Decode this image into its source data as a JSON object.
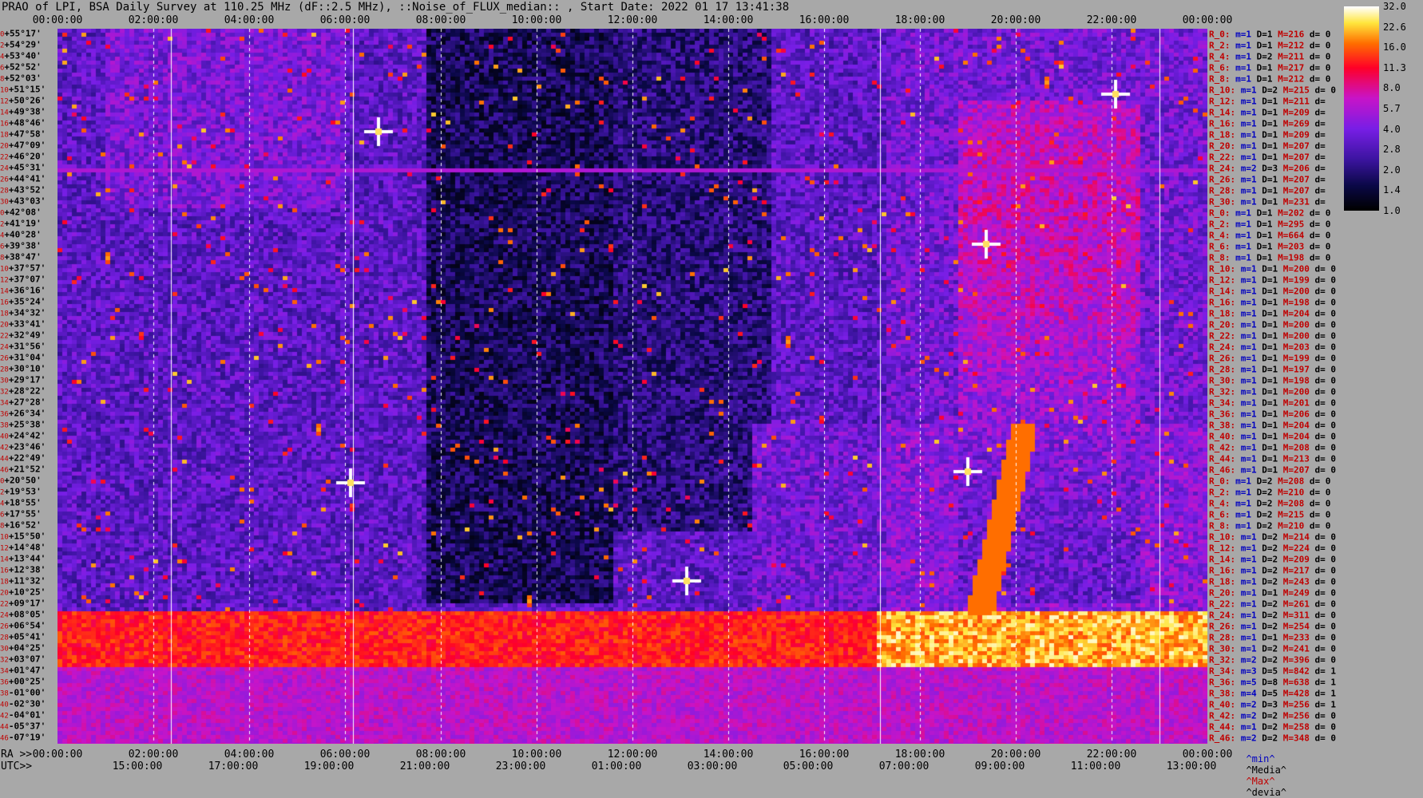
{
  "title": "PRAO of LPI, BSA Daily Survey at 110.25 MHz (dF::2.5 MHz), ::Noise_of_FLUX_median:: , Start Date: 2022 01 17 13:41:38",
  "chart_data": {
    "type": "heatmap",
    "title": "PRAO of LPI, BSA Daily Survey at 110.25 MHz (dF::2.5 MHz), ::Noise_of_FLUX_median:: , Start Date: 2022 01 17 13:41:38",
    "top_axis_labels": [
      "00:00:00",
      "02:00:00",
      "04:00:00",
      "06:00:00",
      "08:00:00",
      "10:00:00",
      "12:00:00",
      "14:00:00",
      "16:00:00",
      "18:00:00",
      "20:00:00",
      "22:00:00",
      "00:00:00"
    ],
    "bottom_ra_prefix": "RA >>",
    "bottom_ra_labels": [
      "00:00:00",
      "02:00:00",
      "04:00:00",
      "06:00:00",
      "08:00:00",
      "10:00:00",
      "12:00:00",
      "14:00:00",
      "16:00:00",
      "18:00:00",
      "20:00:00",
      "22:00:00",
      "00:00:00"
    ],
    "bottom_utc_prefix": "UTC>>",
    "bottom_utc_labels": [
      "15:00:00",
      "17:00:00",
      "19:00:00",
      "21:00:00",
      "23:00:00",
      "01:00:00",
      "03:00:00",
      "05:00:00",
      "07:00:00",
      "09:00:00",
      "11:00:00",
      "13:00:00"
    ],
    "declinations": [
      "+55°17'",
      "+54°29'",
      "+53°40'",
      "+52°52'",
      "+52°03'",
      "+51°15'",
      "+50°26'",
      "+49°38'",
      "+48°46'",
      "+47°58'",
      "+47°09'",
      "+46°20'",
      "+45°31'",
      "+44°41'",
      "+43°52'",
      "+43°03'",
      "+42°08'",
      "+41°19'",
      "+40°28'",
      "+39°38'",
      "+38°47'",
      "+37°57'",
      "+37°07'",
      "+36°16'",
      "+35°24'",
      "+34°32'",
      "+33°41'",
      "+32°49'",
      "+31°56'",
      "+31°04'",
      "+30°10'",
      "+29°17'",
      "+28°22'",
      "+27°28'",
      "+26°34'",
      "+25°38'",
      "+24°42'",
      "+23°46'",
      "+22°49'",
      "+21°52'",
      "+20°50'",
      "+19°53'",
      "+18°55'",
      "+17°55'",
      "+16°52'",
      "+15°50'",
      "+14°48'",
      "+13°44'",
      "+12°38'",
      "+11°32'",
      "+10°25'",
      "+09°17'",
      "+08°05'",
      "+06°54'",
      "+05°41'",
      "+04°25'",
      "+03°07'",
      "+01°47'",
      "+00°25'",
      "-01°00'",
      "-02°30'",
      "-04°01'",
      "-05°37'",
      "-07°19'"
    ],
    "row_indices": [
      "0",
      "2",
      "4",
      "6",
      "8",
      "10",
      "12",
      "14",
      "16",
      "18",
      "20",
      "22",
      "24",
      "26",
      "28",
      "30",
      "0",
      "2",
      "4",
      "6",
      "8",
      "10",
      "12",
      "14",
      "16",
      "18",
      "20",
      "22",
      "24",
      "26",
      "28",
      "30",
      "32",
      "34",
      "36",
      "38",
      "40",
      "42",
      "44",
      "46",
      "0",
      "2",
      "4",
      "6",
      "8",
      "10",
      "12",
      "14",
      "16",
      "18",
      "20",
      "22",
      "24",
      "26",
      "28",
      "30",
      "32",
      "34",
      "36",
      "38",
      "40",
      "42",
      "44",
      "46"
    ],
    "row_stats": [
      {
        "r": "R_0:",
        "m": "m=1",
        "D": "D=1",
        "M": "M=216",
        "d": "d= 0"
      },
      {
        "r": "R_2:",
        "m": "m=1",
        "D": "D=1",
        "M": "M=212",
        "d": "d= 0"
      },
      {
        "r": "R_4:",
        "m": "m=1",
        "D": "D=2",
        "M": "M=211",
        "d": "d= 0"
      },
      {
        "r": "R_6:",
        "m": "m=1",
        "D": "D=1",
        "M": "M=217",
        "d": "d= 0"
      },
      {
        "r": "R_8:",
        "m": "m=1",
        "D": "D=1",
        "M": "M=212",
        "d": "d= 0"
      },
      {
        "r": "R_10:",
        "m": "m=1",
        "D": "D=2",
        "M": "M=215",
        "d": "d= 0"
      },
      {
        "r": "R_12:",
        "m": "m=1",
        "D": "D=1",
        "M": "M=211",
        "d": "d="
      },
      {
        "r": "R_14:",
        "m": "m=1",
        "D": "D=1",
        "M": "M=209",
        "d": "d="
      },
      {
        "r": "R_16:",
        "m": "m=1",
        "D": "D=1",
        "M": "M=269",
        "d": "d="
      },
      {
        "r": "R_18:",
        "m": "m=1",
        "D": "D=1",
        "M": "M=209",
        "d": "d="
      },
      {
        "r": "R_20:",
        "m": "m=1",
        "D": "D=1",
        "M": "M=207",
        "d": "d="
      },
      {
        "r": "R_22:",
        "m": "m=1",
        "D": "D=1",
        "M": "M=207",
        "d": "d="
      },
      {
        "r": "R_24:",
        "m": "m=2",
        "D": "D=3",
        "M": "M=206",
        "d": "d="
      },
      {
        "r": "R_26:",
        "m": "m=1",
        "D": "D=1",
        "M": "M=207",
        "d": "d="
      },
      {
        "r": "R_28:",
        "m": "m=1",
        "D": "D=1",
        "M": "M=207",
        "d": "d="
      },
      {
        "r": "R_30:",
        "m": "m=1",
        "D": "D=1",
        "M": "M=231",
        "d": "d="
      },
      {
        "r": "R_0:",
        "m": "m=1",
        "D": "D=1",
        "M": "M=202",
        "d": "d= 0"
      },
      {
        "r": "R_2:",
        "m": "m=1",
        "D": "D=1",
        "M": "M=295",
        "d": "d= 0"
      },
      {
        "r": "R_4:",
        "m": "m=1",
        "D": "D=1",
        "M": "M=664",
        "d": "d= 0"
      },
      {
        "r": "R_6:",
        "m": "m=1",
        "D": "D=1",
        "M": "M=203",
        "d": "d= 0"
      },
      {
        "r": "R_8:",
        "m": "m=1",
        "D": "D=1",
        "M": "M=198",
        "d": "d= 0"
      },
      {
        "r": "R_10:",
        "m": "m=1",
        "D": "D=1",
        "M": "M=200",
        "d": "d= 0"
      },
      {
        "r": "R_12:",
        "m": "m=1",
        "D": "D=1",
        "M": "M=199",
        "d": "d= 0"
      },
      {
        "r": "R_14:",
        "m": "m=1",
        "D": "D=1",
        "M": "M=200",
        "d": "d= 0"
      },
      {
        "r": "R_16:",
        "m": "m=1",
        "D": "D=1",
        "M": "M=198",
        "d": "d= 0"
      },
      {
        "r": "R_18:",
        "m": "m=1",
        "D": "D=1",
        "M": "M=204",
        "d": "d= 0"
      },
      {
        "r": "R_20:",
        "m": "m=1",
        "D": "D=1",
        "M": "M=200",
        "d": "d= 0"
      },
      {
        "r": "R_22:",
        "m": "m=1",
        "D": "D=1",
        "M": "M=200",
        "d": "d= 0"
      },
      {
        "r": "R_24:",
        "m": "m=1",
        "D": "D=1",
        "M": "M=203",
        "d": "d= 0"
      },
      {
        "r": "R_26:",
        "m": "m=1",
        "D": "D=1",
        "M": "M=199",
        "d": "d= 0"
      },
      {
        "r": "R_28:",
        "m": "m=1",
        "D": "D=1",
        "M": "M=197",
        "d": "d= 0"
      },
      {
        "r": "R_30:",
        "m": "m=1",
        "D": "D=1",
        "M": "M=198",
        "d": "d= 0"
      },
      {
        "r": "R_32:",
        "m": "m=1",
        "D": "D=1",
        "M": "M=200",
        "d": "d= 0"
      },
      {
        "r": "R_34:",
        "m": "m=1",
        "D": "D=1",
        "M": "M=201",
        "d": "d= 0"
      },
      {
        "r": "R_36:",
        "m": "m=1",
        "D": "D=1",
        "M": "M=206",
        "d": "d= 0"
      },
      {
        "r": "R_38:",
        "m": "m=1",
        "D": "D=1",
        "M": "M=204",
        "d": "d= 0"
      },
      {
        "r": "R_40:",
        "m": "m=1",
        "D": "D=1",
        "M": "M=204",
        "d": "d= 0"
      },
      {
        "r": "R_42:",
        "m": "m=1",
        "D": "D=1",
        "M": "M=208",
        "d": "d= 0"
      },
      {
        "r": "R_44:",
        "m": "m=1",
        "D": "D=1",
        "M": "M=213",
        "d": "d= 0"
      },
      {
        "r": "R_46:",
        "m": "m=1",
        "D": "D=1",
        "M": "M=207",
        "d": "d= 0"
      },
      {
        "r": "R_0:",
        "m": "m=1",
        "D": "D=2",
        "M": "M=208",
        "d": "d= 0"
      },
      {
        "r": "R_2:",
        "m": "m=1",
        "D": "D=2",
        "M": "M=210",
        "d": "d= 0"
      },
      {
        "r": "R_4:",
        "m": "m=1",
        "D": "D=2",
        "M": "M=208",
        "d": "d= 0"
      },
      {
        "r": "R_6:",
        "m": "m=1",
        "D": "D=2",
        "M": "M=215",
        "d": "d= 0"
      },
      {
        "r": "R_8:",
        "m": "m=1",
        "D": "D=2",
        "M": "M=210",
        "d": "d= 0"
      },
      {
        "r": "R_10:",
        "m": "m=1",
        "D": "D=2",
        "M": "M=214",
        "d": "d= 0"
      },
      {
        "r": "R_12:",
        "m": "m=1",
        "D": "D=2",
        "M": "M=224",
        "d": "d= 0"
      },
      {
        "r": "R_14:",
        "m": "m=1",
        "D": "D=2",
        "M": "M=209",
        "d": "d= 0"
      },
      {
        "r": "R_16:",
        "m": "m=1",
        "D": "D=2",
        "M": "M=217",
        "d": "d= 0"
      },
      {
        "r": "R_18:",
        "m": "m=1",
        "D": "D=2",
        "M": "M=243",
        "d": "d= 0"
      },
      {
        "r": "R_20:",
        "m": "m=1",
        "D": "D=1",
        "M": "M=249",
        "d": "d= 0"
      },
      {
        "r": "R_22:",
        "m": "m=1",
        "D": "D=2",
        "M": "M=261",
        "d": "d= 0"
      },
      {
        "r": "R_24:",
        "m": "m=1",
        "D": "D=2",
        "M": "M=311",
        "d": "d= 0"
      },
      {
        "r": "R_26:",
        "m": "m=1",
        "D": "D=2",
        "M": "M=254",
        "d": "d= 0"
      },
      {
        "r": "R_28:",
        "m": "m=1",
        "D": "D=1",
        "M": "M=233",
        "d": "d= 0"
      },
      {
        "r": "R_30:",
        "m": "m=1",
        "D": "D=2",
        "M": "M=241",
        "d": "d= 0"
      },
      {
        "r": "R_32:",
        "m": "m=2",
        "D": "D=2",
        "M": "M=396",
        "d": "d= 0"
      },
      {
        "r": "R_34:",
        "m": "m=3",
        "D": "D=5",
        "M": "M=842",
        "d": "d= 1"
      },
      {
        "r": "R_36:",
        "m": "m=5",
        "D": "D=8",
        "M": "M=638",
        "d": "d= 1"
      },
      {
        "r": "R_38:",
        "m": "m=4",
        "D": "D=5",
        "M": "M=428",
        "d": "d= 1"
      },
      {
        "r": "R_40:",
        "m": "m=2",
        "D": "D=3",
        "M": "M=256",
        "d": "d= 1"
      },
      {
        "r": "R_42:",
        "m": "m=2",
        "D": "D=2",
        "M": "M=256",
        "d": "d= 0"
      },
      {
        "r": "R_44:",
        "m": "m=1",
        "D": "D=2",
        "M": "M=258",
        "d": "d= 0"
      },
      {
        "r": "R_46:",
        "m": "m=2",
        "D": "D=2",
        "M": "M=348",
        "d": "d= 0"
      }
    ],
    "colorbar": {
      "ticks": [
        "32.0",
        "22.6",
        "16.0",
        "11.3",
        "8.0",
        "5.7",
        "4.0",
        "2.8",
        "2.0",
        "1.4",
        "1.0"
      ],
      "scale": "log",
      "range": [
        1.0,
        32.0
      ]
    },
    "legend": {
      "min": "^min^",
      "median": "^Media^",
      "max": "^Max^",
      "deviation": "^devia^"
    },
    "colors": {
      "background": "#a8a8a8",
      "low": "#000000",
      "mid": "#6a0dd8",
      "high": "#ff0000",
      "peak": "#ffffff"
    }
  }
}
